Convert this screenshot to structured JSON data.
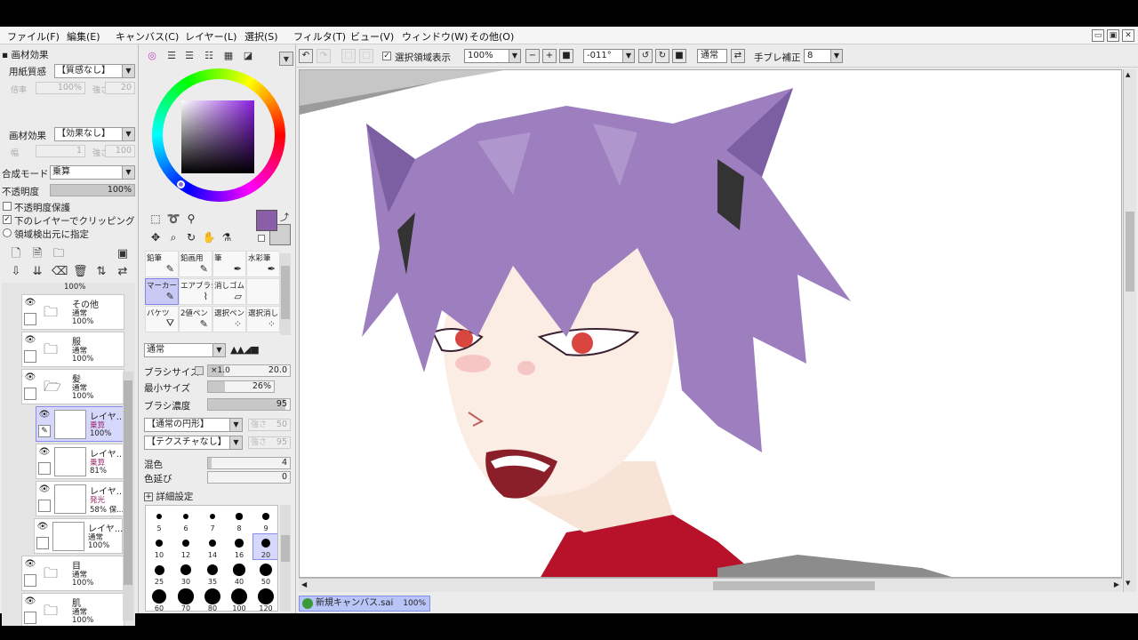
{
  "menu": [
    "ファイル(F)",
    "編集(E)",
    "キャンバス(C)",
    "レイヤー(L)",
    "選択(S)",
    "フィルタ(T)",
    "ビュー(V)",
    "ウィンドウ(W)",
    "その他(O)"
  ],
  "window_buttons": [
    "▭",
    "▣",
    "✕"
  ],
  "left": {
    "section_title": "画材効果",
    "paper_label": "用紙質感",
    "paper_value": "【質感なし】",
    "paper_rate_label": "倍率",
    "paper_rate_value": "100%",
    "paper_strength_label": "強さ",
    "paper_strength_value": "20",
    "effect_label": "画材効果",
    "effect_value": "【効果なし】",
    "effect_width_label": "幅",
    "effect_width_value": "1",
    "effect_strength_label": "強さ",
    "effect_strength_value": "100",
    "blend_label": "合成モード",
    "blend_value": "乗算",
    "opacity_label": "不透明度",
    "opacity_value": "100%",
    "opacity_fill": 1.0,
    "protect_label": "不透明度保護",
    "clip_label": "下のレイヤーでクリッピング",
    "detect_label": "領域検出元に指定"
  },
  "layers": {
    "top_partial_opacity": "100%",
    "items": [
      {
        "name": "その他",
        "mode": "通常",
        "opacity": "100%",
        "type": "folder"
      },
      {
        "name": "服",
        "mode": "通常",
        "opacity": "100%",
        "type": "folder"
      },
      {
        "name": "髪",
        "mode": "通常",
        "opacity": "100%",
        "type": "folder-open"
      },
      {
        "name": "レイヤ...",
        "mode": "乗算",
        "opacity": "100%",
        "type": "layer",
        "selected": true
      },
      {
        "name": "レイヤ...",
        "mode": "乗算",
        "opacity": "81%",
        "type": "layer"
      },
      {
        "name": "レイヤ...",
        "mode": "発光",
        "opacity": "58%",
        "extra": "保...",
        "type": "layer"
      },
      {
        "name": "レイヤ...",
        "mode": "通常",
        "opacity": "100%",
        "type": "layer"
      },
      {
        "name": "目",
        "mode": "通常",
        "opacity": "100%",
        "type": "folder"
      },
      {
        "name": "肌",
        "mode": "通常",
        "opacity": "100%",
        "type": "folder"
      }
    ]
  },
  "tools": {
    "main_color": "#8a5fa8",
    "sub_color": "#cfcfcf",
    "brushes": [
      {
        "label": "鉛筆",
        "icon": "✎"
      },
      {
        "label": "鉛画用",
        "icon": "✎"
      },
      {
        "label": "筆",
        "icon": "✒"
      },
      {
        "label": "水彩筆",
        "icon": "✒"
      },
      {
        "label": "マーカー",
        "icon": "✎",
        "selected": true
      },
      {
        "label": "エアブラシ",
        "icon": "⌇"
      },
      {
        "label": "消しゴム",
        "icon": "▱"
      },
      {
        "label": "",
        "icon": ""
      },
      {
        "label": "バケツ",
        "icon": "⛛"
      },
      {
        "label": "2値ペン",
        "icon": "✎"
      },
      {
        "label": "選択ペン",
        "icon": "⁘"
      },
      {
        "label": "選択消し",
        "icon": "⁘"
      }
    ],
    "mode_value": "通常",
    "brush_size_label": "ブラシサイズ",
    "brush_size_mult": "×1.0",
    "brush_size_value": "20.0",
    "min_size_label": "最小サイズ",
    "min_size_value": "26%",
    "min_size_fill": 0.26,
    "density_label": "ブラシ濃度",
    "density_value": "95",
    "density_fill": 0.95,
    "shape_value": "【通常の円形】",
    "shape_strength": "50",
    "texture_value": "【テクスチャなし】",
    "texture_strength": "95",
    "strength_label": "強さ",
    "mix_label": "混色",
    "mix_value": "4",
    "mix_fill": 0.04,
    "extend_label": "色延び",
    "extend_value": "0",
    "extend_fill": 0.0,
    "detail_label": "詳細設定",
    "sizes": [
      "5",
      "6",
      "7",
      "8",
      "9",
      "10",
      "12",
      "14",
      "16",
      "20",
      "25",
      "30",
      "35",
      "40",
      "50",
      "60",
      "70",
      "80",
      "100",
      "120"
    ],
    "selected_size": "20"
  },
  "toolbar": {
    "show_selection_label": "選択領域表示",
    "zoom_value": "100%",
    "rotation_value": "-011°",
    "blend_value": "通常",
    "stabilizer_label": "手ブレ補正",
    "stabilizer_value": "8"
  },
  "status": {
    "doc_name": "新規キャンバス.sai",
    "doc_zoom": "100%"
  }
}
